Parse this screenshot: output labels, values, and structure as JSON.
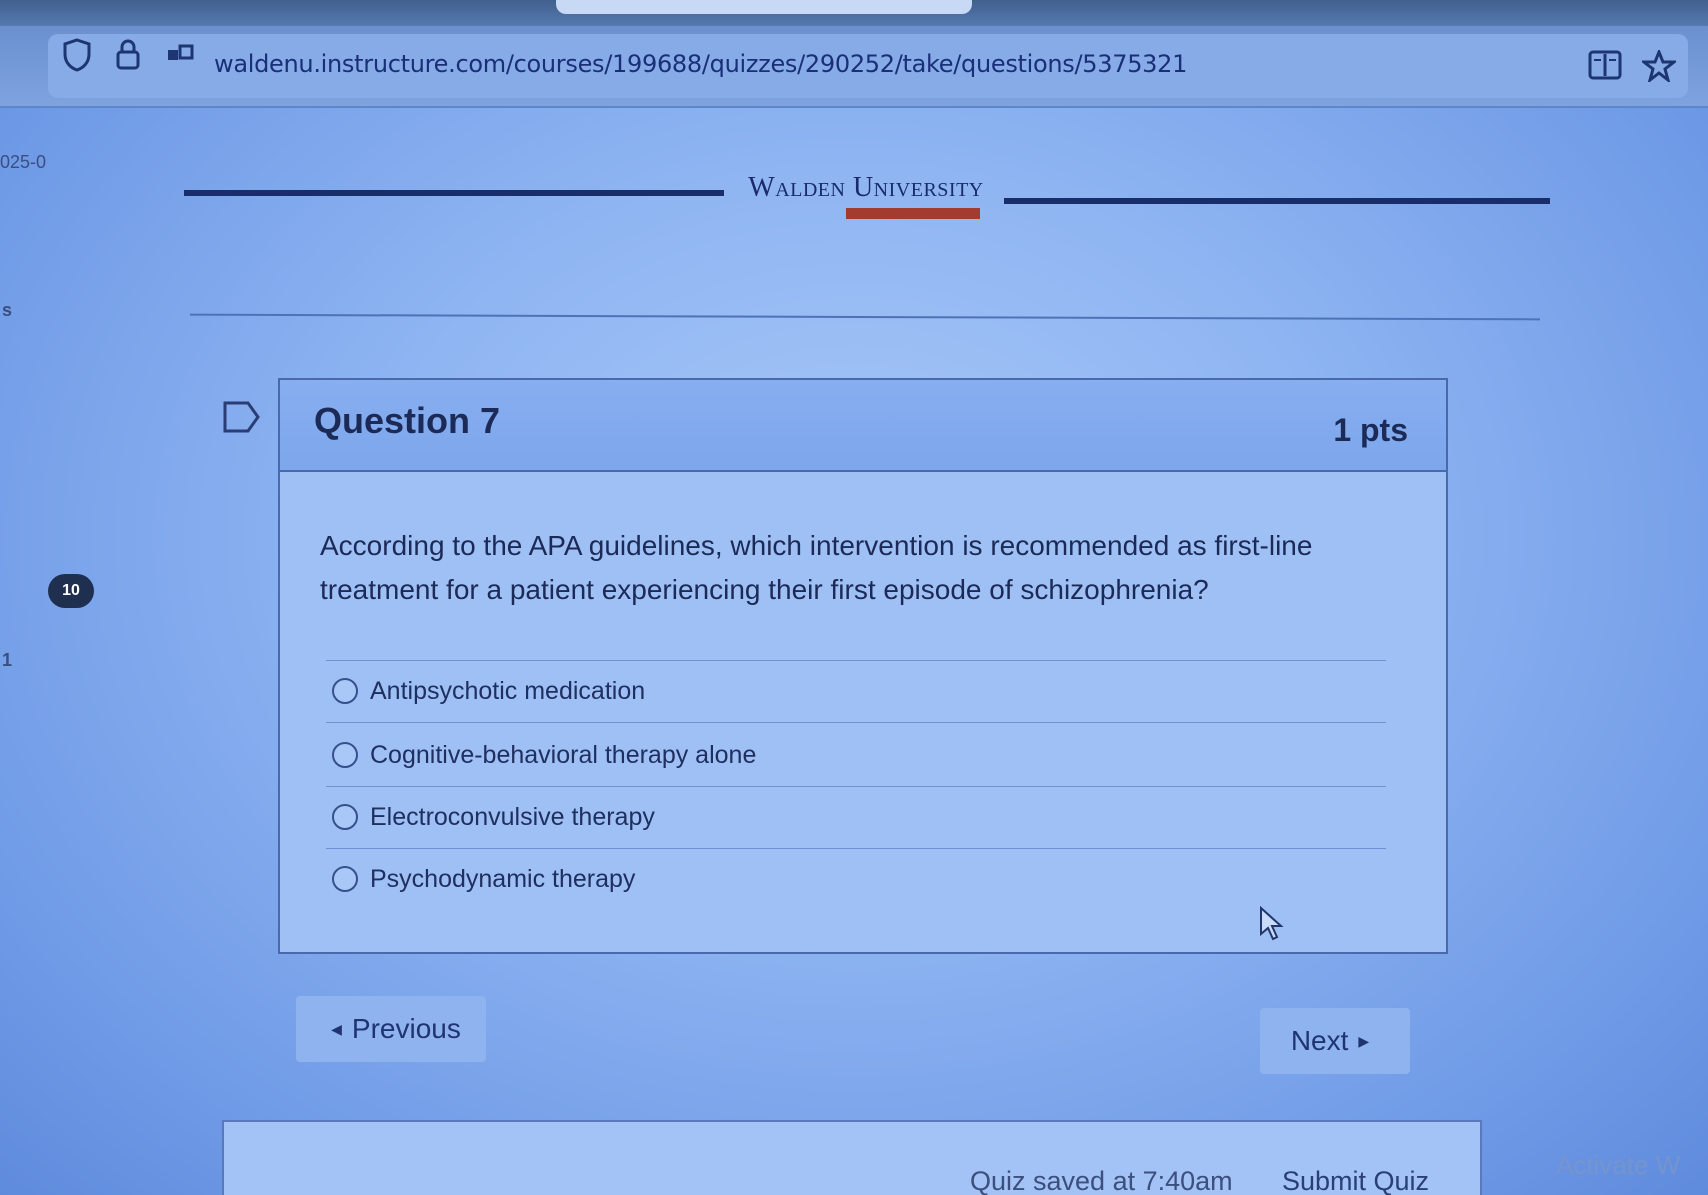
{
  "browser": {
    "url": "waldenu.instructure.com/courses/199688/quizzes/290252/take/questions/5375321"
  },
  "sidebar": {
    "edge_fragments": [
      "025-0",
      "s",
      "1"
    ],
    "question_badge": "10"
  },
  "banner": {
    "logo_text": "Walden University"
  },
  "question": {
    "title": "Question 7",
    "points": "1 pts",
    "text": "According to the APA guidelines, which intervention is recommended as first-line treatment for a patient experiencing their first episode of schizophrenia?",
    "answers": [
      {
        "label": "Antipsychotic medication",
        "selected": false
      },
      {
        "label": "Cognitive-behavioral therapy alone",
        "selected": false
      },
      {
        "label": "Electroconvulsive therapy",
        "selected": false
      },
      {
        "label": "Psychodynamic therapy",
        "selected": false
      }
    ]
  },
  "navigation": {
    "previous_label": "Previous",
    "next_label": "Next"
  },
  "footer": {
    "saved_status": "Quiz saved at 7:40am",
    "submit_label": "Submit Quiz",
    "watermark": "Activate W"
  },
  "colors": {
    "accent": "#1a2d6b",
    "card_border": "#4a69ad",
    "badge": "#1f2f4f",
    "logo_strip": "#a33b2e"
  },
  "icons": [
    "shield-icon",
    "lock-icon",
    "permissions-icon",
    "reader-view-icon",
    "bookmark-star-icon",
    "flag-icon",
    "cursor-icon"
  ]
}
